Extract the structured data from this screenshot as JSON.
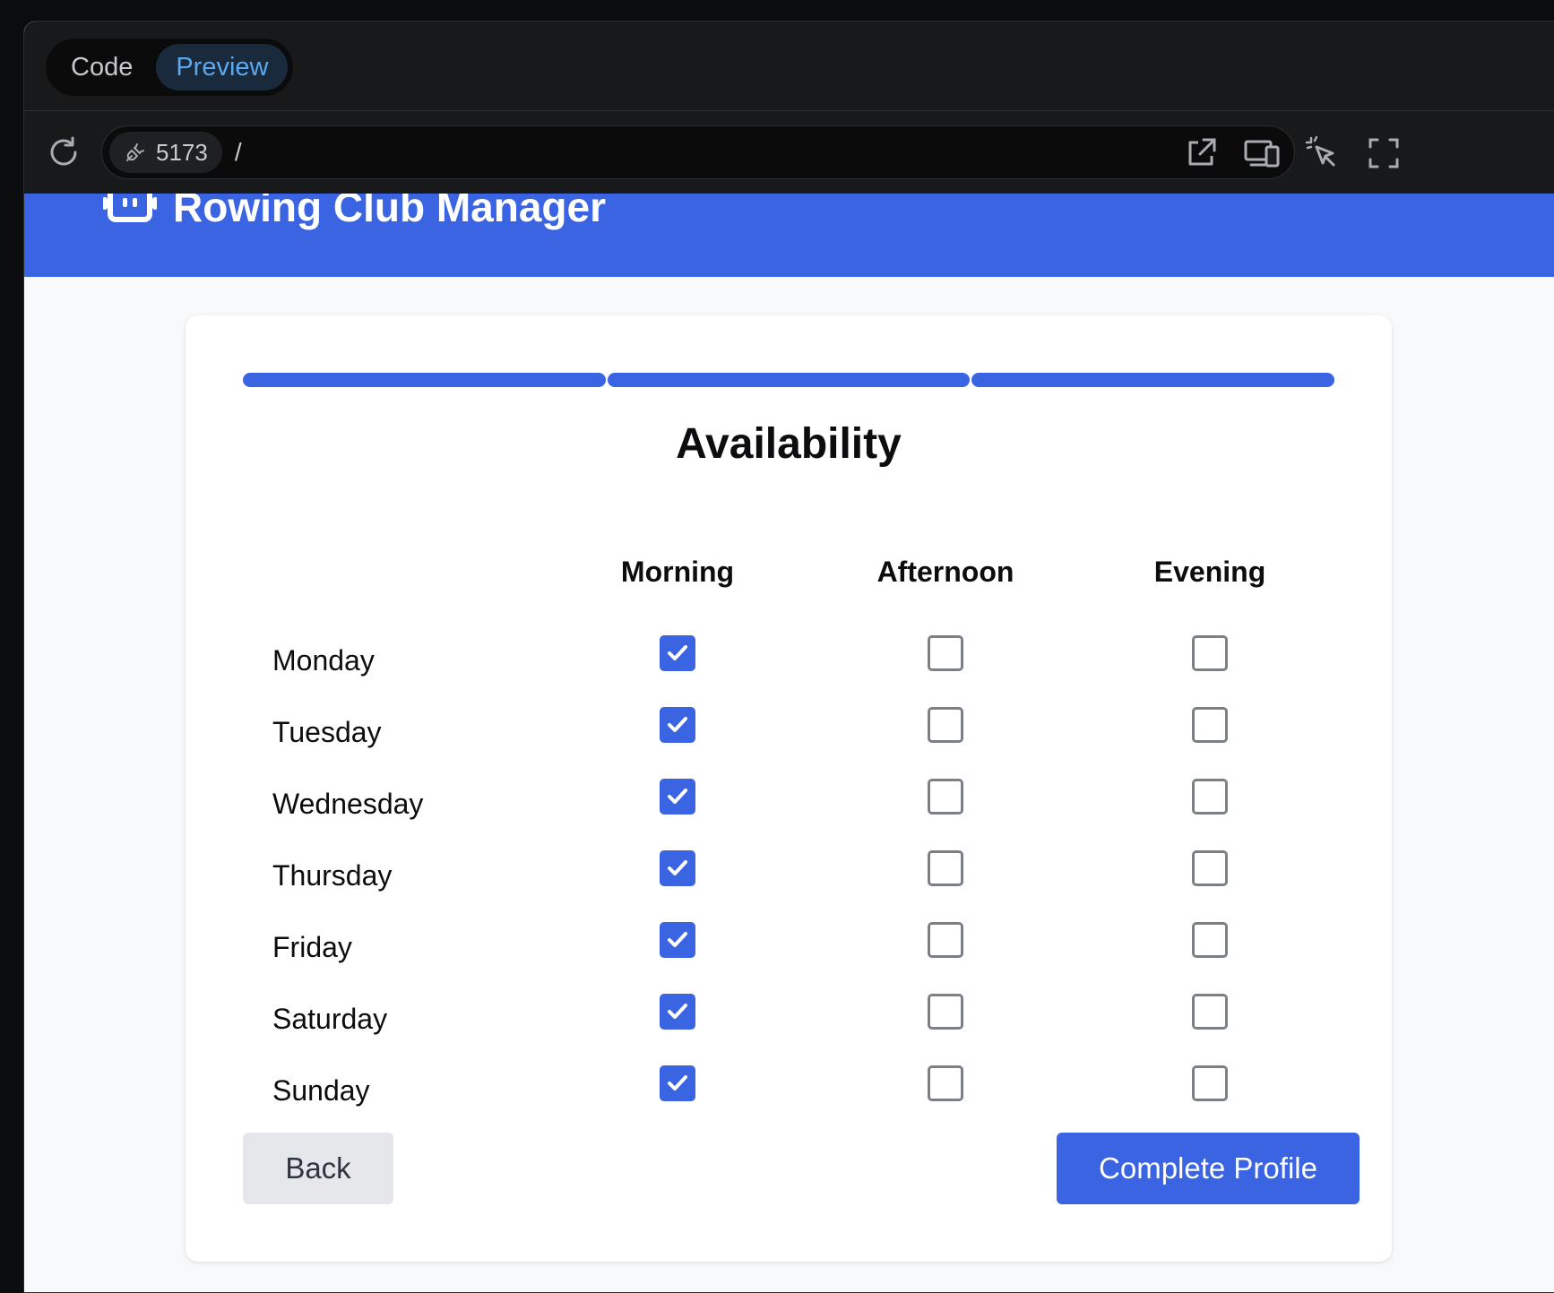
{
  "devtools": {
    "tabs": [
      {
        "label": "Code",
        "active": false
      },
      {
        "label": "Preview",
        "active": true
      }
    ],
    "port": "5173",
    "path": "/",
    "icons": [
      "reload-icon",
      "plug-icon",
      "open-external-icon",
      "responsive-devices-icon",
      "element-select-icon",
      "fullscreen-icon"
    ]
  },
  "app": {
    "title": "Rowing Club Manager",
    "brand_color": "#3b64e2"
  },
  "form": {
    "progress_steps_total": 3,
    "progress_steps_completed": 3,
    "title": "Availability",
    "columns": [
      "Morning",
      "Afternoon",
      "Evening"
    ],
    "rows": [
      {
        "day": "Monday",
        "morning": true,
        "afternoon": false,
        "evening": false
      },
      {
        "day": "Tuesday",
        "morning": true,
        "afternoon": false,
        "evening": false
      },
      {
        "day": "Wednesday",
        "morning": true,
        "afternoon": false,
        "evening": false
      },
      {
        "day": "Thursday",
        "morning": true,
        "afternoon": false,
        "evening": false
      },
      {
        "day": "Friday",
        "morning": true,
        "afternoon": false,
        "evening": false
      },
      {
        "day": "Saturday",
        "morning": true,
        "afternoon": false,
        "evening": false
      },
      {
        "day": "Sunday",
        "morning": true,
        "afternoon": false,
        "evening": false
      }
    ],
    "back_label": "Back",
    "submit_label": "Complete Profile"
  }
}
